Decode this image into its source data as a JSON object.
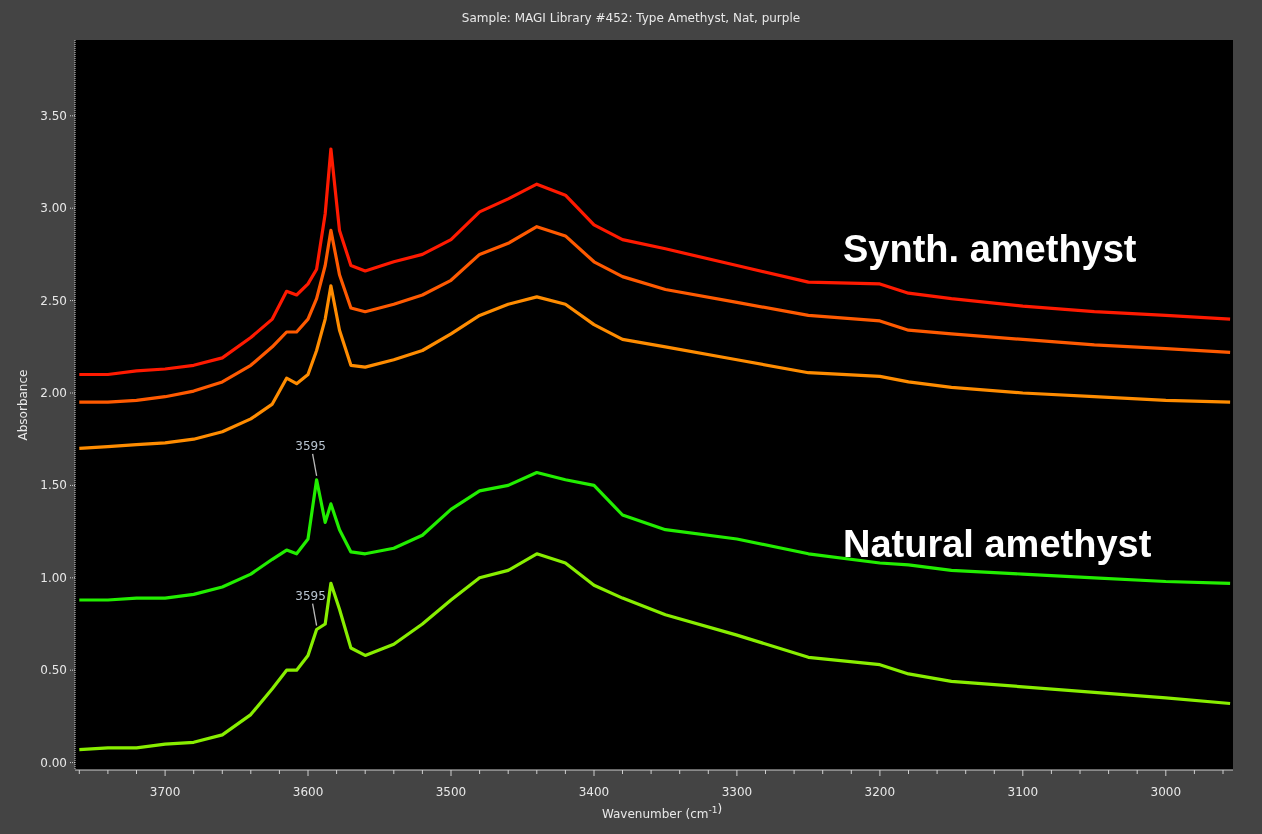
{
  "window": {
    "title": "Sample: MAGI Library #452: Type Amethyst, Nat, purple"
  },
  "plot": {
    "chart_data": {
      "type": "line",
      "xlabel": "Wavenumber (cm$^{-1}$)",
      "ylabel": "Absorbance",
      "x": [
        3760,
        3740,
        3720,
        3700,
        3680,
        3660,
        3640,
        3625,
        3615,
        3608,
        3600,
        3594,
        3588,
        3584,
        3578,
        3570,
        3560,
        3540,
        3520,
        3500,
        3480,
        3460,
        3440,
        3420,
        3400,
        3380,
        3350,
        3300,
        3250,
        3200,
        3180,
        3150,
        3100,
        3050,
        3000,
        2955
      ],
      "series": [
        {
          "color": "#ff1a00",
          "values": [
            2.1,
            2.1,
            2.12,
            2.13,
            2.15,
            2.19,
            2.3,
            2.4,
            2.55,
            2.53,
            2.59,
            2.67,
            2.97,
            3.32,
            2.88,
            2.69,
            2.66,
            2.71,
            2.75,
            2.83,
            2.98,
            3.05,
            3.13,
            3.07,
            2.91,
            2.83,
            2.78,
            2.69,
            2.6,
            2.59,
            2.54,
            2.51,
            2.47,
            2.44,
            2.42,
            2.4
          ]
        },
        {
          "color": "#ff5a00",
          "values": [
            1.95,
            1.95,
            1.96,
            1.98,
            2.01,
            2.06,
            2.15,
            2.25,
            2.33,
            2.33,
            2.4,
            2.51,
            2.69,
            2.88,
            2.64,
            2.46,
            2.44,
            2.48,
            2.53,
            2.61,
            2.75,
            2.81,
            2.9,
            2.85,
            2.71,
            2.63,
            2.56,
            2.49,
            2.42,
            2.39,
            2.34,
            2.32,
            2.29,
            2.26,
            2.24,
            2.22
          ]
        },
        {
          "color": "#ff8c00",
          "values": [
            1.7,
            1.71,
            1.72,
            1.73,
            1.75,
            1.79,
            1.86,
            1.94,
            2.08,
            2.05,
            2.1,
            2.23,
            2.4,
            2.58,
            2.34,
            2.15,
            2.14,
            2.18,
            2.23,
            2.32,
            2.42,
            2.48,
            2.52,
            2.48,
            2.37,
            2.29,
            2.25,
            2.18,
            2.11,
            2.09,
            2.06,
            2.03,
            2.0,
            1.98,
            1.96,
            1.95
          ]
        },
        {
          "color": "#22ee00",
          "values": [
            0.88,
            0.88,
            0.89,
            0.89,
            0.91,
            0.95,
            1.02,
            1.1,
            1.15,
            1.13,
            1.21,
            1.53,
            1.3,
            1.4,
            1.26,
            1.14,
            1.13,
            1.16,
            1.23,
            1.37,
            1.47,
            1.5,
            1.57,
            1.53,
            1.5,
            1.34,
            1.26,
            1.21,
            1.13,
            1.08,
            1.07,
            1.04,
            1.02,
            1.0,
            0.98,
            0.97
          ]
        },
        {
          "color": "#88ee00",
          "values": [
            0.07,
            0.08,
            0.08,
            0.1,
            0.11,
            0.15,
            0.26,
            0.4,
            0.5,
            0.5,
            0.58,
            0.72,
            0.75,
            0.97,
            0.83,
            0.62,
            0.58,
            0.64,
            0.75,
            0.88,
            1.0,
            1.04,
            1.13,
            1.08,
            0.96,
            0.89,
            0.8,
            0.69,
            0.57,
            0.53,
            0.48,
            0.44,
            0.41,
            0.38,
            0.35,
            0.32
          ]
        }
      ],
      "xlim": [
        3763,
        2953
      ],
      "ylim": [
        -0.04,
        3.91
      ],
      "xticks": [
        3700,
        3600,
        3500,
        3400,
        3300,
        3200,
        3100,
        3000
      ],
      "yticks": [
        {
          "value": 0,
          "label": "0.00"
        },
        {
          "value": 0.5,
          "label": "0.50"
        },
        {
          "value": 1,
          "label": "1.00"
        },
        {
          "value": 1.5,
          "label": "1.50"
        },
        {
          "value": 2,
          "label": "2.00"
        },
        {
          "value": 2.5,
          "label": "2.50"
        },
        {
          "value": 3,
          "label": "3.00"
        },
        {
          "value": 3.5,
          "label": "3.50"
        }
      ],
      "annotations": [
        "Synth. amethyst",
        "Natural amethyst",
        {
          "text": "3595",
          "x": 3594,
          "y": 1.53
        },
        {
          "text": "3595",
          "x": 3594,
          "y": 0.72
        }
      ]
    }
  }
}
